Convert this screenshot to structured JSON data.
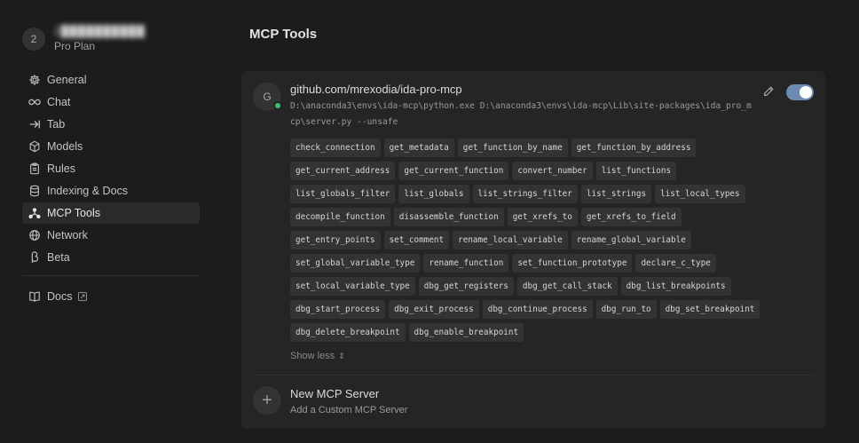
{
  "user": {
    "avatar_initial": "2",
    "name": "2██████████",
    "plan": "Pro Plan"
  },
  "sidebar": {
    "items": [
      {
        "label": "General",
        "icon": "gear-icon"
      },
      {
        "label": "Chat",
        "icon": "infinity-icon"
      },
      {
        "label": "Tab",
        "icon": "tab-arrow-icon"
      },
      {
        "label": "Models",
        "icon": "cube-icon"
      },
      {
        "label": "Rules",
        "icon": "clipboard-icon"
      },
      {
        "label": "Indexing & Docs",
        "icon": "database-icon"
      },
      {
        "label": "MCP Tools",
        "icon": "mcp-network-icon",
        "active": true
      },
      {
        "label": "Network",
        "icon": "globe-icon"
      },
      {
        "label": "Beta",
        "icon": "beta-icon"
      }
    ],
    "docs": {
      "label": "Docs",
      "icon": "book-icon",
      "external_icon": "external-link-icon"
    }
  },
  "main": {
    "title": "MCP Tools",
    "server": {
      "avatar_initial": "G",
      "status": "connected",
      "status_color": "#3fbf6f",
      "name": "github.com/mrexodia/ida-pro-mcp",
      "command": "D:\\anaconda3\\envs\\ida-mcp\\python.exe D:\\anaconda3\\envs\\ida-mcp\\Lib\\site-packages\\ida_pro_mcp\\server.py --unsafe",
      "enabled": true,
      "toggle_color": "#6d8bb0",
      "tools": [
        "check_connection",
        "get_metadata",
        "get_function_by_name",
        "get_function_by_address",
        "get_current_address",
        "get_current_function",
        "convert_number",
        "list_functions",
        "list_globals_filter",
        "list_globals",
        "list_strings_filter",
        "list_strings",
        "list_local_types",
        "decompile_function",
        "disassemble_function",
        "get_xrefs_to",
        "get_xrefs_to_field",
        "get_entry_points",
        "set_comment",
        "rename_local_variable",
        "rename_global_variable",
        "set_global_variable_type",
        "rename_function",
        "set_function_prototype",
        "declare_c_type",
        "set_local_variable_type",
        "dbg_get_registers",
        "dbg_get_call_stack",
        "dbg_list_breakpoints",
        "dbg_start_process",
        "dbg_exit_process",
        "dbg_continue_process",
        "dbg_run_to",
        "dbg_set_breakpoint",
        "dbg_delete_breakpoint",
        "dbg_enable_breakpoint"
      ],
      "show_less_label": "Show less"
    },
    "add_server": {
      "title": "New MCP Server",
      "subtitle": "Add a Custom MCP Server"
    }
  }
}
